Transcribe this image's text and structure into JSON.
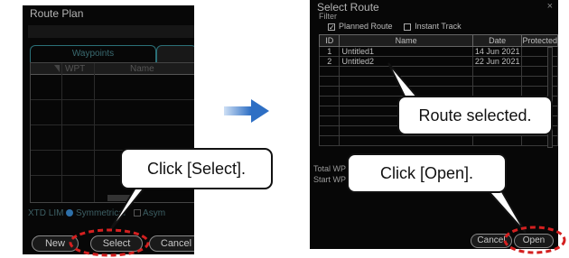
{
  "route_plan": {
    "title": "Route Plan",
    "tabs": [
      "Waypoints",
      ""
    ],
    "columns": [
      "WPT",
      "Name"
    ],
    "xtd_label": "XTD LIM",
    "radio_symmetric": "Symmetrical",
    "radio_asymmetric": "Asym",
    "buttons": {
      "new": "New",
      "select": "Select",
      "cancel": "Cancel"
    }
  },
  "select_route": {
    "title": "Select Route",
    "filter_label": "Filter",
    "filter_planned": "Planned Route",
    "filter_instant": "Instant Track",
    "columns": [
      "ID",
      "Name",
      "Date",
      "Protected"
    ],
    "rows": [
      {
        "id": "1",
        "name": "Untitled1",
        "date": "14 Jun 2021",
        "protected": ""
      },
      {
        "id": "2",
        "name": "Untitled2",
        "date": "22 Jun 2021",
        "protected": ""
      }
    ],
    "total_label": "Total WP",
    "start_label": "Start WP",
    "buttons": {
      "cancel": "Cancel",
      "open": "Open"
    }
  },
  "callouts": {
    "click_select": "Click [Select].",
    "route_selected": "Route selected.",
    "click_open": "Click [Open]."
  },
  "colors": {
    "arrow": "#2e6fc4",
    "highlight_ring": "#d42020",
    "selection": "#4fb6c4"
  }
}
